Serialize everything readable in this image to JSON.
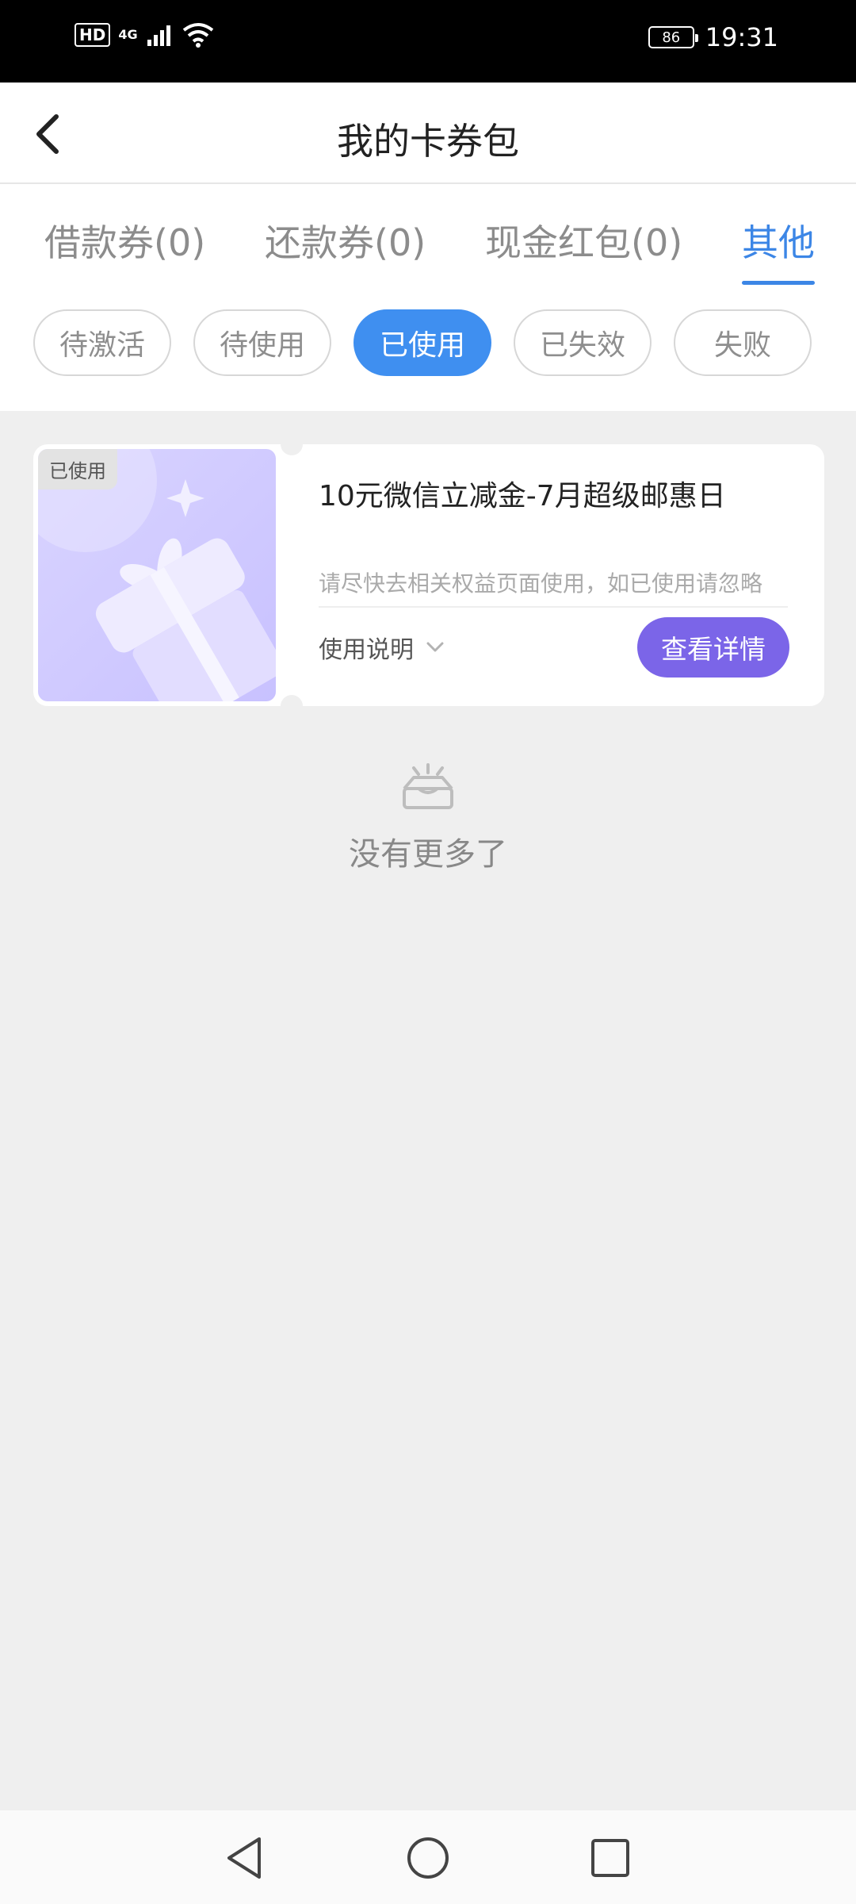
{
  "status_bar": {
    "hd": "HD",
    "network": "4G",
    "battery": "86",
    "time": "19:31"
  },
  "header": {
    "title": "我的卡券包"
  },
  "tabs": [
    {
      "label": "借款券(0)",
      "active": false
    },
    {
      "label": "还款券(0)",
      "active": false
    },
    {
      "label": "现金红包(0)",
      "active": false
    },
    {
      "label": "其他",
      "active": true
    }
  ],
  "filters": [
    {
      "label": "待激活",
      "active": false
    },
    {
      "label": "待使用",
      "active": false
    },
    {
      "label": "已使用",
      "active": true
    },
    {
      "label": "已失效",
      "active": false
    },
    {
      "label": "失败",
      "active": false
    }
  ],
  "coupon": {
    "status_tag": "已使用",
    "title": "10元微信立减金-7月超级邮惠日",
    "subtitle": "请尽快去相关权益页面使用，如已使用请忽略",
    "help_label": "使用说明",
    "detail_button": "查看详情"
  },
  "empty": {
    "text": "没有更多了"
  },
  "colors": {
    "accent_blue": "#3f8ff0",
    "detail_purple": "#7b65e8"
  }
}
